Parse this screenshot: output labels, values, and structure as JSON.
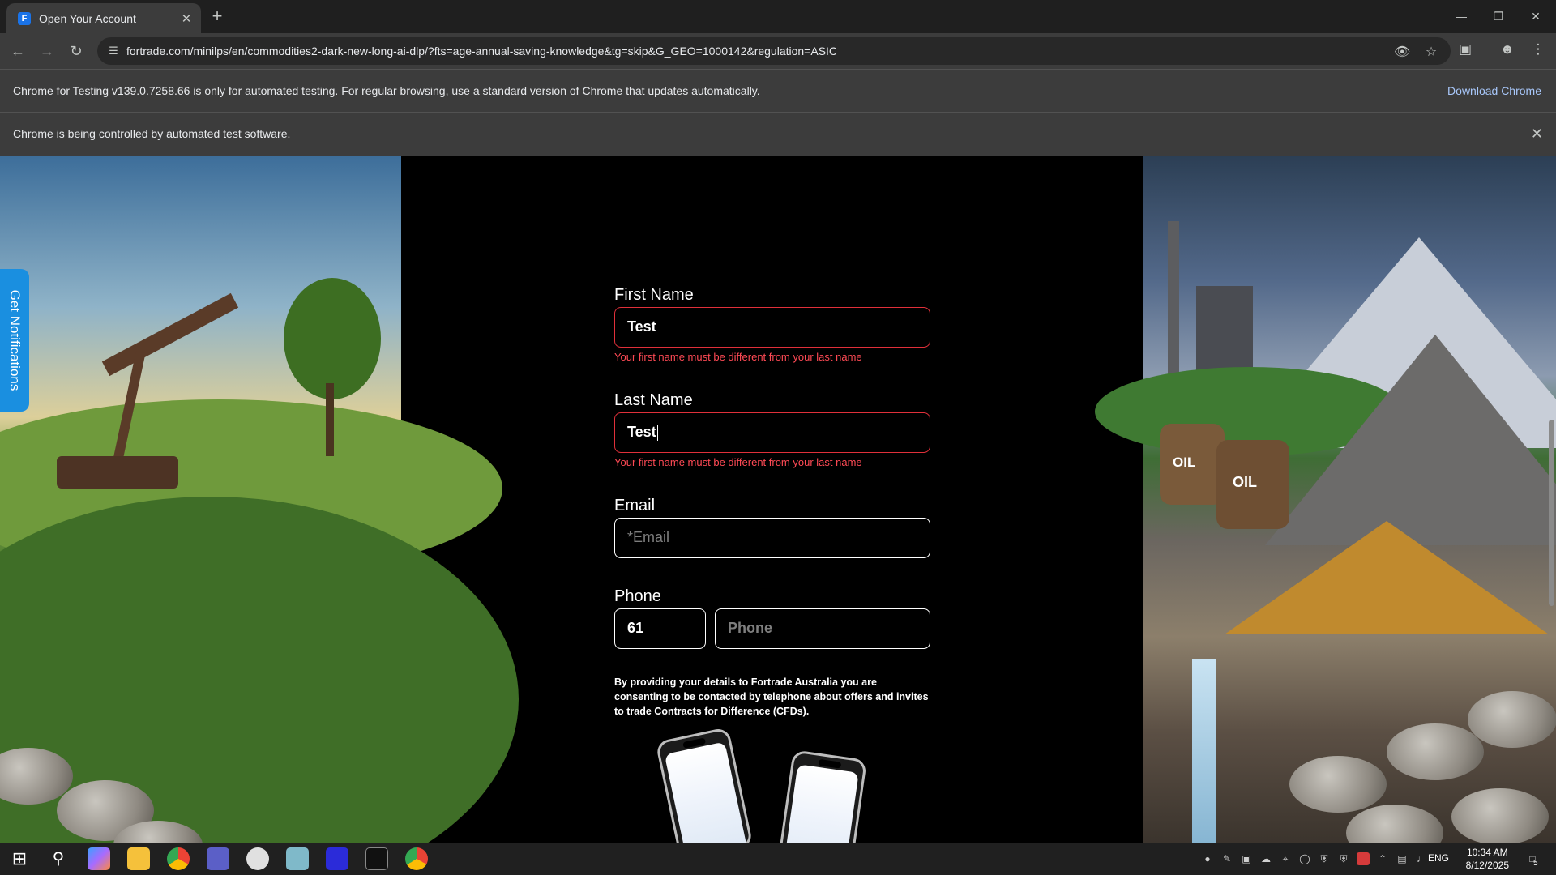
{
  "browser": {
    "tab_title": "Open Your Account",
    "tab_close": "✕",
    "new_tab": "+",
    "url": "fortrade.com/minilps/en/commodities2-dark-new-long-ai-dlp/?fts=age-annual-saving-knowledge&tg=skip&G_GEO=1000142&regulation=ASIC",
    "infobar_testing": "Chrome for Testing v139.0.7258.66 is only for automated testing. For regular browsing, use a standard version of Chrome that updates automatically.",
    "download_link": "Download Chrome",
    "infobar_automation": "Chrome is being controlled by automated test software."
  },
  "side_tab": {
    "label": "Get Notifications"
  },
  "form": {
    "first_name_label": "First Name",
    "first_name_value": "Test",
    "first_name_error": "Your first name must be different from your last name",
    "last_name_label": "Last Name",
    "last_name_value": "Test",
    "last_name_error": "Your first name must be different from your last name",
    "email_label": "Email",
    "email_placeholder": "*Email",
    "phone_label": "Phone",
    "phone_code": "61",
    "phone_placeholder": "Phone",
    "consent": "By providing your details to Fortrade Australia you are consenting to be contacted by telephone about offers and invites to trade Contracts for Difference (CFDs)."
  },
  "art": {
    "barrel_label": "OIL"
  },
  "taskbar": {
    "language": "ENG",
    "time": "10:34 AM",
    "date": "8/12/2025",
    "notification_count": "5"
  },
  "colors": {
    "error": "#e0303a",
    "side_tab": "#1a8fe0",
    "link": "#a8c7fa"
  }
}
